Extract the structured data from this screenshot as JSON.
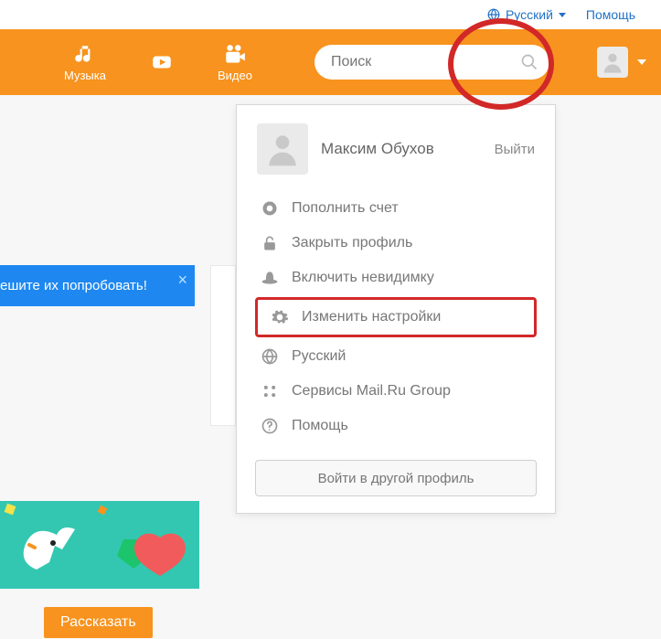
{
  "top": {
    "language_label": "Русский",
    "help_label": "Помощь"
  },
  "nav": {
    "music_label": "Музыка",
    "video_label": "Видео"
  },
  "search": {
    "placeholder": "Поиск"
  },
  "dropdown": {
    "user_name": "Максим Обухов",
    "logout": "Выйти",
    "items": [
      {
        "icon": "wallet",
        "label": "Пополнить счет"
      },
      {
        "icon": "lock",
        "label": "Закрыть профиль"
      },
      {
        "icon": "hat",
        "label": "Включить невидимку"
      },
      {
        "icon": "gear",
        "label": "Изменить настройки",
        "highlighted": true
      },
      {
        "icon": "globe",
        "label": "Русский"
      },
      {
        "icon": "grid",
        "label": "Сервисы Mail.Ru Group"
      },
      {
        "icon": "help",
        "label": "Помощь"
      }
    ],
    "other_profile_btn": "Войти в другой профиль"
  },
  "banner": {
    "text": "ешите их попробовать!"
  },
  "tell_button": "Рассказать"
}
